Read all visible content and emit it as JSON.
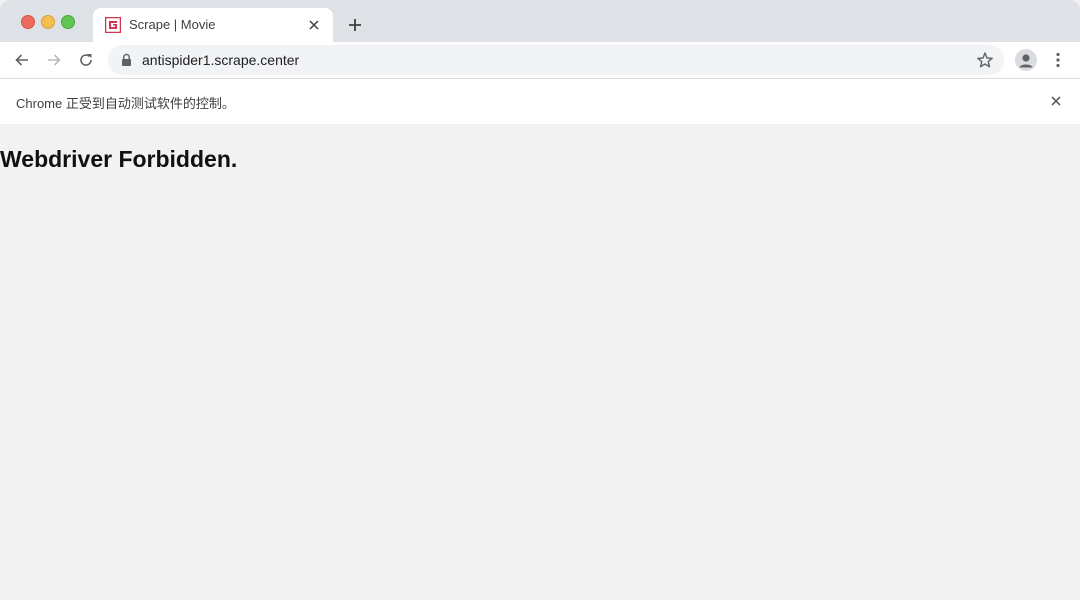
{
  "window": {
    "traffic_lights": {
      "close": "#ed6a5e",
      "minimize": "#f5bf4f",
      "maximize": "#61c554"
    }
  },
  "tab": {
    "title": "Scrape | Movie",
    "favicon": "scrape-logo-icon",
    "favicon_color": "#d0354f",
    "close_icon": "close-icon"
  },
  "toolbar": {
    "back_icon": "arrow-left-icon",
    "forward_icon": "arrow-right-icon",
    "reload_icon": "reload-icon",
    "url": "antispider1.scrape.center",
    "lock_icon": "lock-icon",
    "bookmark_icon": "star-icon",
    "profile_icon": "profile-icon",
    "menu_icon": "kebab-menu-icon"
  },
  "infobar": {
    "text": "Chrome 正受到自动测试软件的控制。",
    "close_icon": "close-icon"
  },
  "content": {
    "heading": "Webdriver Forbidden."
  }
}
